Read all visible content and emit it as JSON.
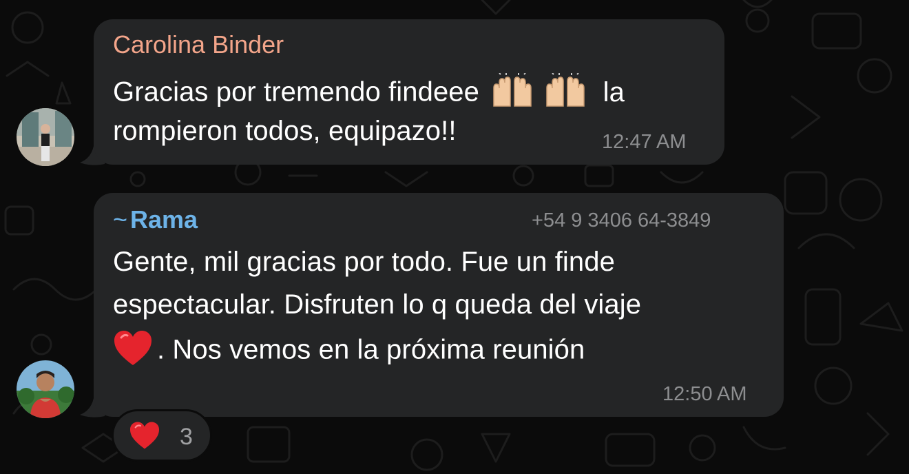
{
  "messages": [
    {
      "sender": "Carolina Binder",
      "lines": [
        "Gracias por tremendo findeee",
        "la",
        "rompieron todos, equipazo!!"
      ],
      "emojis": [
        "raising-hands",
        "raising-hands"
      ],
      "time": "12:47 AM"
    },
    {
      "sender_prefix": "~",
      "sender": "Rama",
      "phone": "+54 9 3406 64-3849",
      "lines": [
        "Gente, mil gracias por todo. Fue un finde",
        "espectacular. Disfruten lo q queda del viaje",
        ". Nos vemos en la próxima reunión"
      ],
      "emojis": [
        "red-heart"
      ],
      "time": "12:50 AM",
      "reaction": {
        "emoji": "red-heart",
        "count": "3"
      }
    }
  ],
  "colors": {
    "background": "#0b0b0b",
    "bubble": "#242526",
    "sender_1": "#f3a58a",
    "sender_2": "#6db3e8",
    "meta_text": "#8d8e90"
  }
}
